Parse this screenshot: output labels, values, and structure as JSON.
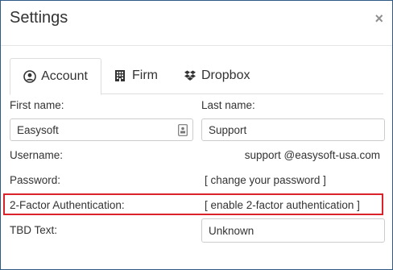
{
  "dialog": {
    "title": "Settings",
    "close_glyph": "×"
  },
  "tabs": [
    {
      "label": "Account",
      "icon": "user-circle-icon",
      "active": true
    },
    {
      "label": "Firm",
      "icon": "building-icon",
      "active": false
    },
    {
      "label": "Dropbox",
      "icon": "dropbox-icon",
      "active": false
    }
  ],
  "form": {
    "first_name": {
      "label": "First name:",
      "value": "Easysoft"
    },
    "last_name": {
      "label": "Last name:",
      "value": "Support"
    },
    "username": {
      "label": "Username:",
      "value": "support @easysoft-usa.com"
    },
    "password": {
      "label": "Password:",
      "link": "[ change your password ]"
    },
    "two_factor": {
      "label": "2-Factor Authentication:",
      "link": "[ enable 2-factor authentication ]"
    },
    "tbd": {
      "label": "TBD Text:",
      "value": "Unknown"
    }
  },
  "colors": {
    "highlight": "#d9222a",
    "frame": "#2f5a86"
  }
}
